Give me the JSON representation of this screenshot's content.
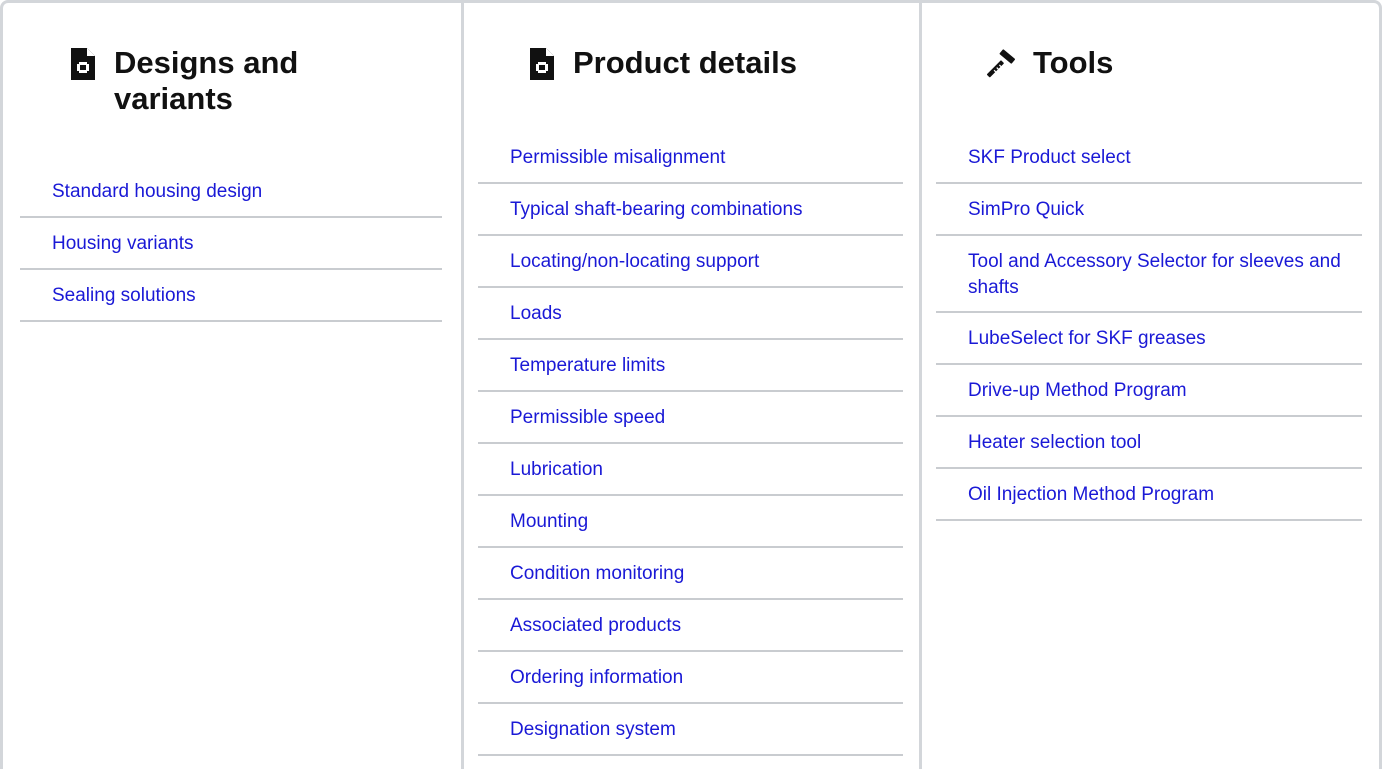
{
  "columns": [
    {
      "icon": "document-icon",
      "title": "Designs and variants",
      "links": [
        "Standard housing design",
        "Housing variants",
        "Sealing solutions"
      ]
    },
    {
      "icon": "document-icon",
      "title": "Product details",
      "links": [
        "Permissible misalignment",
        "Typical shaft-bearing combinations",
        "Locating/non-locating support",
        "Loads",
        "Temperature limits",
        "Permissible speed",
        "Lubrication",
        "Mounting",
        "Condition monitoring",
        "Associated products",
        "Ordering information",
        "Designation system"
      ]
    },
    {
      "icon": "hammer-ruler-icon",
      "title": "Tools",
      "links": [
        "SKF Product select",
        "SimPro Quick",
        "Tool and Accessory Selector for sleeves and shafts",
        "LubeSelect for SKF greases",
        "Drive-up Method Program",
        "Heater selection tool",
        "Oil Injection Method Program"
      ]
    }
  ],
  "colors": {
    "link": "#1a19d6",
    "heading": "#111111",
    "divider": "#c9ccd0",
    "border": "#d3d6da"
  }
}
